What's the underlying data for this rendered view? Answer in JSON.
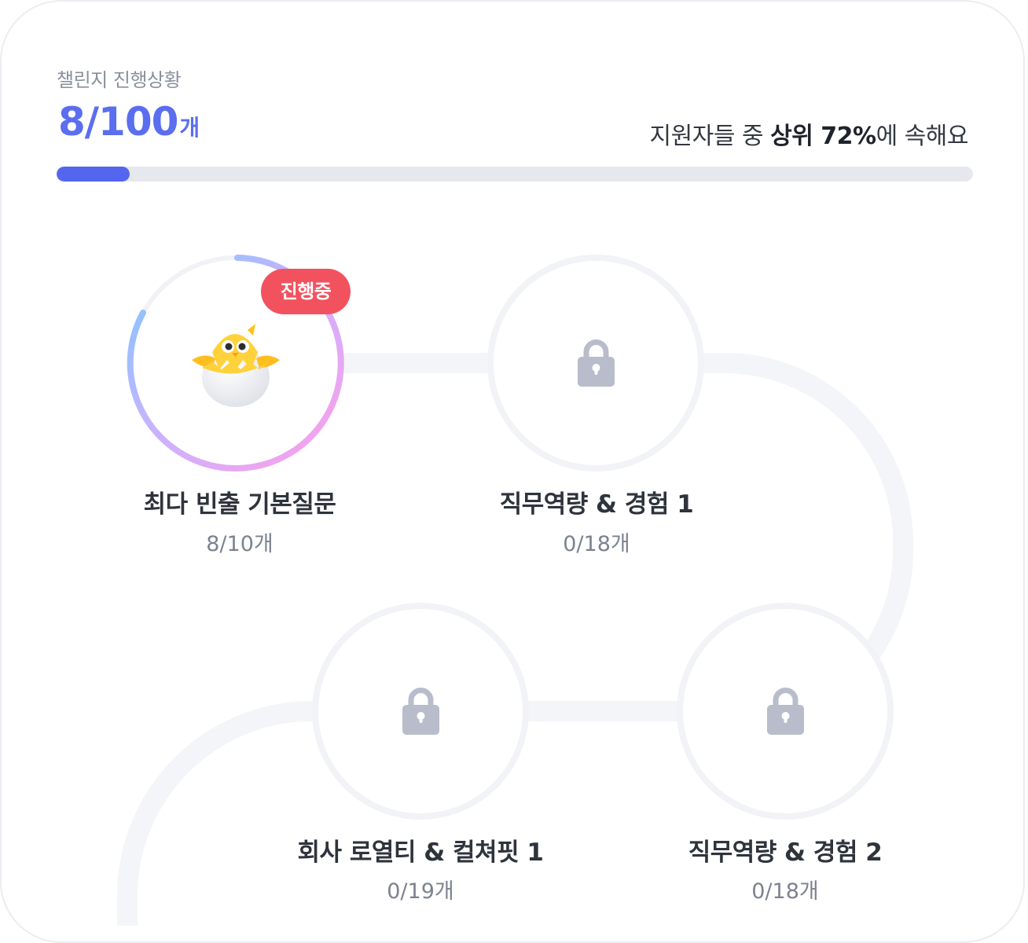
{
  "progress": {
    "label": "챌린지 진행상황",
    "count": "8/100",
    "unit": "개",
    "completed": 8,
    "total": 100,
    "fraction": 0.08,
    "rank_prefix": "지원자들 중 ",
    "rank_bold": "상위 72%",
    "rank_suffix": "에 속해요"
  },
  "colors": {
    "accent": "#5566ee",
    "badge": "#f2525e",
    "track": "#e7e8ee",
    "lock": "#b9bccb"
  },
  "stages": [
    {
      "title": "최다 빈출 기본질문",
      "count": "8/10개",
      "status": "진행중",
      "icon": "chick-icon",
      "locked": false
    },
    {
      "title": "직무역량 & 경험 1",
      "count": "0/18개",
      "icon": "lock-icon",
      "locked": true
    },
    {
      "title": "회사 로열티 & 컬쳐핏 1",
      "count": "0/19개",
      "icon": "lock-icon",
      "locked": true
    },
    {
      "title": "직무역량 & 경험 2",
      "count": "0/18개",
      "icon": "lock-icon",
      "locked": true
    }
  ]
}
